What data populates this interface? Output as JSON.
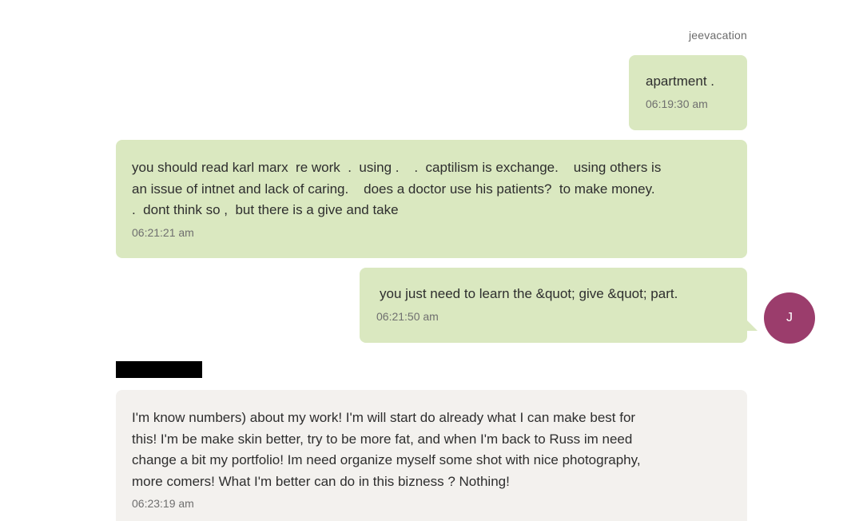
{
  "conversation": {
    "sender_name": "jeevacation",
    "avatar_initial": "J",
    "messages": [
      {
        "direction": "outgoing",
        "text": "apartment .",
        "time": "06:19:30 am"
      },
      {
        "direction": "outgoing",
        "text": "you should read karl marx  re work  .  using .    .  captilism is exchange.    using others is\nan issue of intnet and lack of caring.    does a doctor use his patients?  to make money.\n.  dont think so ,  but there is a give and take",
        "time": "06:21:21 am"
      },
      {
        "direction": "outgoing",
        "text": "you just need to learn the &quot; give &quot; part.",
        "time": "06:21:50 am"
      },
      {
        "direction": "incoming",
        "text": "I'm know numbers) about my work! I'm will start do already what I can make best for\nthis! I'm be make skin better, try to be more fat, and when I'm back to Russ im need\nchange a bit my portfolio! Im need organize myself some shot with nice photography,\nmore comers! What I'm better can do in this bizness ? Nothing!",
        "time": "06:23:19 am"
      }
    ]
  },
  "colors": {
    "outgoing_bubble": "#dae8c0",
    "incoming_bubble": "#f3f1ee",
    "avatar": "#9b3d6c",
    "redaction": "#000000"
  }
}
